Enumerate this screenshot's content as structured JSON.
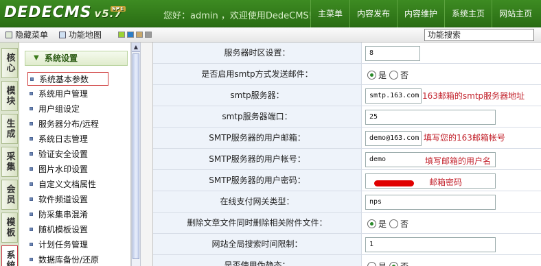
{
  "header": {
    "logo": "DEDECMS",
    "version": "v5.7",
    "badge": "SP1",
    "welcome": "您好：admin ，欢迎使用DedeCMS!",
    "nav": [
      "主菜单",
      "内容发布",
      "内容维护",
      "系统主页",
      "网站主页"
    ],
    "bg_color": "#2f7a18"
  },
  "toolbar": {
    "hide_menu": "隐藏菜单",
    "site_map": "功能地图",
    "swatch_colors": [
      "#9bd334",
      "#2b7dc7",
      "#c9a86b",
      "#9a9a9a"
    ],
    "search_value": "功能搜索"
  },
  "vtabs": [
    "核心",
    "模块",
    "生成",
    "采集",
    "会员",
    "模板",
    "系统"
  ],
  "sidemenu": {
    "title": "系统设置",
    "items": [
      "系统基本参数",
      "系统用户管理",
      "用户组设定",
      "服务器分布/远程",
      "系统日志管理",
      "验证安全设置",
      "图片水印设置",
      "自定义文档属性",
      "软件频道设置",
      "防采集串混淆",
      "随机模板设置",
      "计划任务管理",
      "数据库备份/还原"
    ]
  },
  "settings": [
    {
      "label": "服务器时区设置：",
      "type": "text",
      "value": "8"
    },
    {
      "label": "是否启用smtp方式发送邮件：",
      "type": "radio",
      "options": [
        "是",
        "否"
      ],
      "selected": 0
    },
    {
      "label": "smtp服务器：",
      "type": "text",
      "value": "smtp.163.com",
      "note": "163邮箱的smtp服务器地址"
    },
    {
      "label": "smtp服务器端口：",
      "type": "text",
      "value": "25"
    },
    {
      "label": "SMTP服务器的用户邮箱：",
      "type": "text",
      "value": "demo@163.com",
      "note": "填写您的163邮箱帐号"
    },
    {
      "label": "SMTP服务器的用户帐号：",
      "type": "text",
      "value": "demo",
      "note": "填写邮箱的用户名"
    },
    {
      "label": "SMTP服务器的用户密码：",
      "type": "password",
      "value": "",
      "note": "邮箱密码"
    },
    {
      "label": "在线支付网关类型：",
      "type": "text",
      "value": "nps"
    },
    {
      "label": "删除文章文件同时删除相关附件文件：",
      "type": "radio",
      "options": [
        "是",
        "否"
      ],
      "selected": 0
    },
    {
      "label": "网站全局搜索时间限制：",
      "type": "text",
      "value": "1"
    },
    {
      "label": "是否使用伪静态：",
      "type": "radio",
      "options": [
        "是",
        "否"
      ],
      "selected": 1
    }
  ],
  "annotation_color": "#c2202a"
}
